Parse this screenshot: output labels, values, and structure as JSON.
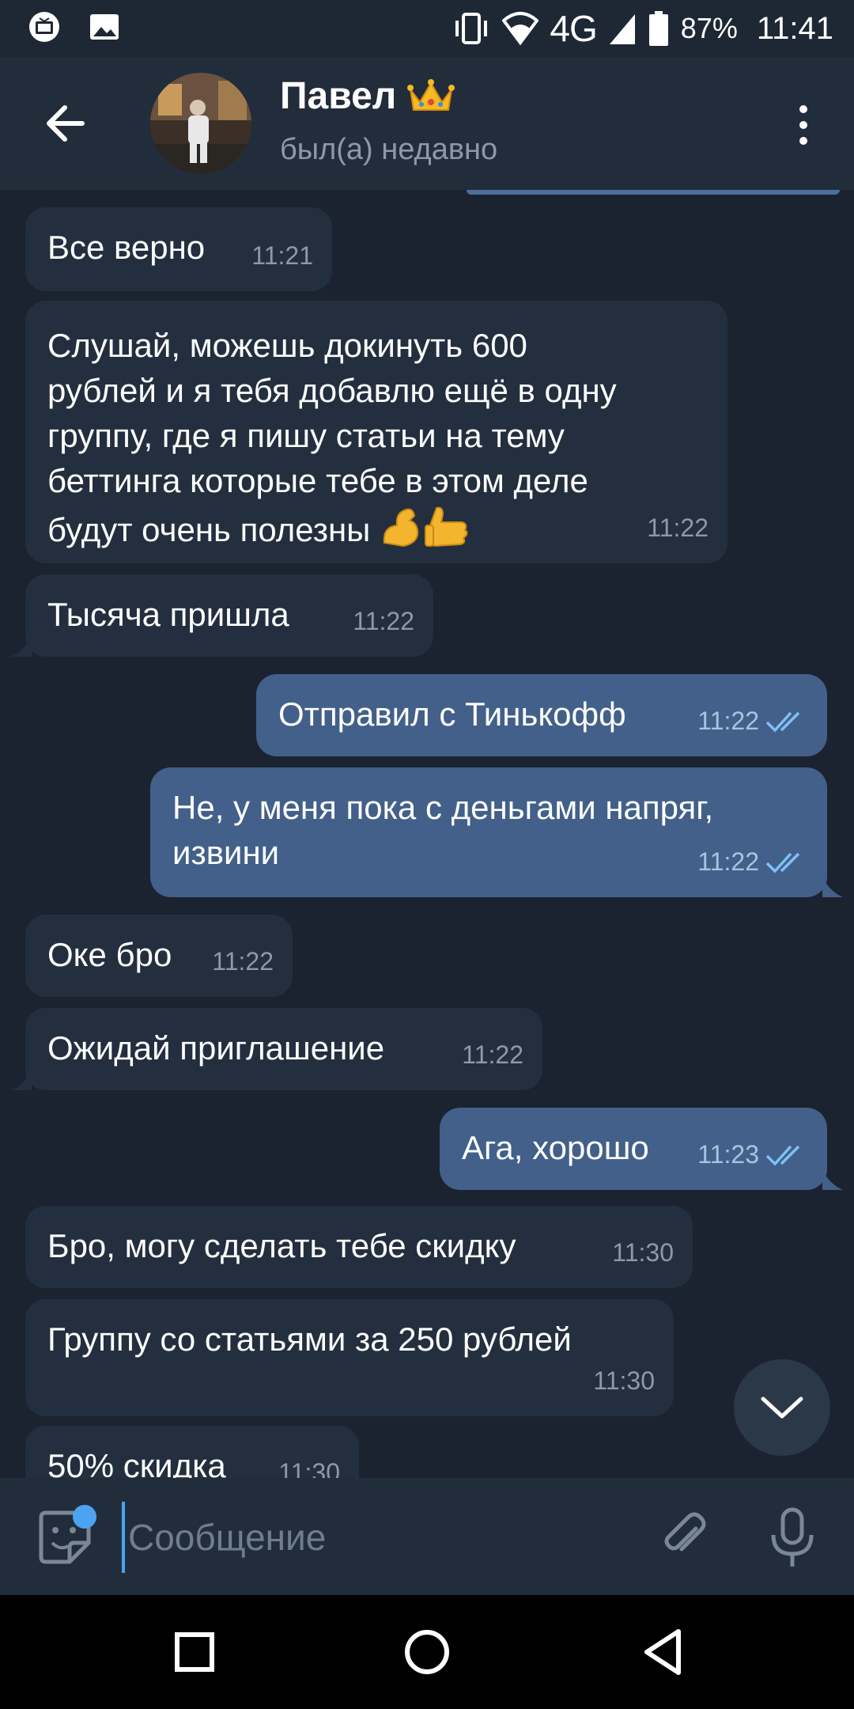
{
  "status_bar": {
    "network": "4G",
    "battery": "87%",
    "time": "11:41"
  },
  "header": {
    "contact_name": "Павел",
    "contact_status": "был(а) недавно"
  },
  "messages": [
    {
      "direction": "in",
      "text": "Все верно",
      "time": "11:21"
    },
    {
      "direction": "in",
      "text": "Слушай, можешь докинуть 600\nрублей и я тебя добавлю ещё в одну\nгруппу, где я пишу статьи на тему\nбеттинга которые тебе в этом деле\nбудут очень полезны",
      "emoji": "💪👍",
      "time": "11:22"
    },
    {
      "direction": "in",
      "text": "Тысяча пришла",
      "time": "11:22"
    },
    {
      "direction": "out",
      "text": "Отправил с Тинькофф",
      "time": "11:22",
      "read": true
    },
    {
      "direction": "out",
      "text": "Не, у меня пока с деньгами напряг,\nизвини",
      "time": "11:22",
      "read": true
    },
    {
      "direction": "in",
      "text": "Оке бро",
      "time": "11:22"
    },
    {
      "direction": "in",
      "text": "Ожидай приглашение",
      "time": "11:22"
    },
    {
      "direction": "out",
      "text": "Ага, хорошо",
      "time": "11:23",
      "read": true
    },
    {
      "direction": "in",
      "text": "Бро, могу сделать тебе скидку",
      "time": "11:30"
    },
    {
      "direction": "in",
      "text": "Группу со статьями за 250 рублей",
      "time": "11:30"
    },
    {
      "direction": "in",
      "text": "50% скидка",
      "time": "11:30"
    }
  ],
  "composer": {
    "placeholder": "Сообщение"
  },
  "colors": {
    "background": "#1b2330",
    "incoming_bubble": "#232f3e",
    "outgoing_bubble": "#426089",
    "header": "#222d3b",
    "accent": "#4ca3f2"
  },
  "icons": {
    "back": "arrow-left-icon",
    "menu": "more-vertical-icon",
    "crown": "crown-emoji",
    "scroll_down": "chevron-down-icon",
    "sticker": "sticker-icon",
    "attach": "paperclip-icon",
    "mic": "microphone-icon",
    "nav_recent": "square-icon",
    "nav_home": "circle-icon",
    "nav_back": "triangle-back-icon"
  }
}
